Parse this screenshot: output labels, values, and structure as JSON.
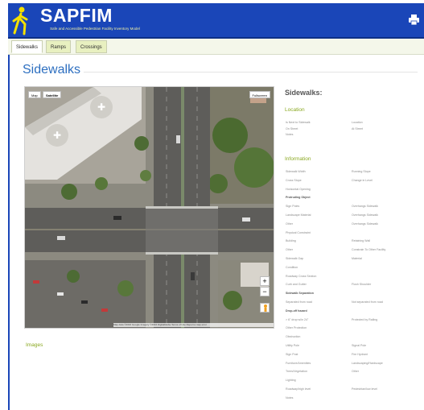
{
  "header": {
    "app_title": "SAPFIM",
    "app_subtitle": "Safe and Accessible Pedestrian Facility Inventory Model",
    "icons": {
      "logo": "pedestrian-walking-icon",
      "print": "printer-icon"
    },
    "colors": {
      "bar": "#1a46b8",
      "subtitle": "#f0f0a0"
    }
  },
  "tabs": [
    {
      "label": "Sidewalks",
      "active": true
    },
    {
      "label": "Ramps",
      "active": false
    },
    {
      "label": "Crossings",
      "active": false
    }
  ],
  "page": {
    "title": "Sidewalks",
    "images_label": "Images"
  },
  "map": {
    "map_type_button": "Map",
    "satellite_button": "Satellite",
    "fullscreen_button": "Fullscreen",
    "zoom_in": "+",
    "zoom_out": "−",
    "attribution": "Map data ©2016 Google Imagery ©2016 DigitalGlobe  Terms of Use  Report a map error"
  },
  "panel": {
    "title": "Sidewalks:",
    "location": {
      "heading": "Location",
      "rows": [
        {
          "left": "Is Next to Sidewalk",
          "right": "Location"
        },
        {
          "left": "On Street",
          "right": "At Street"
        },
        {
          "left": "Notes",
          "right": ""
        }
      ]
    },
    "information": {
      "heading": "Information",
      "rows": [
        {
          "left": "Sidewalk Width",
          "right": "Running Slope",
          "bold": false
        },
        {
          "left": "Cross Slope",
          "right": "Change in Level",
          "bold": false
        },
        {
          "left": "Horizontal Opening",
          "right": "",
          "bold": false
        },
        {
          "left": "Protruding Object",
          "right": "",
          "bold": true
        },
        {
          "left": "Sign Poles",
          "right": "Overhangs Sidewalk",
          "bold": false
        },
        {
          "left": "Landscape Material",
          "right": "Overhangs Sidewalk",
          "bold": false
        },
        {
          "left": "Other",
          "right": "Overhangs Sidewalk",
          "bold": false
        },
        {
          "left": "Physical Constraint",
          "right": "",
          "bold": false
        },
        {
          "left": "Building",
          "right": "Retaining Wall",
          "bold": false
        },
        {
          "left": "Other",
          "right": "Constrain To Other Facility",
          "bold": false
        },
        {
          "left": "Sidewalk Gap",
          "right": "Material",
          "bold": false
        },
        {
          "left": "Condition",
          "right": "",
          "bold": false
        },
        {
          "left": "Roadway Cross Section",
          "right": "",
          "bold": false
        },
        {
          "left": "Curb and Gutter",
          "right": "Flush Shoulder",
          "bold": false
        },
        {
          "left": "Sidewalk Separation",
          "right": "",
          "bold": true
        },
        {
          "left": "Separated from road",
          "right": "Not separated from road",
          "bold": false
        },
        {
          "left": "Drop-off hazard",
          "right": "",
          "bold": true
        },
        {
          "left": "> 6\" drop w/in 24\"",
          "right": "Protected by Railing",
          "bold": false
        },
        {
          "left": "Other Protection",
          "right": "",
          "bold": false
        },
        {
          "left": "Obstruction",
          "right": "",
          "bold": false
        },
        {
          "left": "Utility Pole",
          "right": "Signal Pole",
          "bold": false
        },
        {
          "left": "Sign Post",
          "right": "Fire Hydrant",
          "bold": false
        },
        {
          "left": "Furniture/Amenities",
          "right": "Landscaping/Hardscape",
          "bold": false
        },
        {
          "left": "Trees/Vegetation",
          "right": "Other",
          "bold": false
        },
        {
          "left": "Lighting",
          "right": "",
          "bold": false
        },
        {
          "left": "Roadway/high level",
          "right": "Pedestrian/low level",
          "bold": false
        },
        {
          "left": "Notes",
          "right": "",
          "bold": false
        }
      ]
    },
    "colors": {
      "section_heading": "#8aa820",
      "title": "#2d6fc0"
    }
  }
}
